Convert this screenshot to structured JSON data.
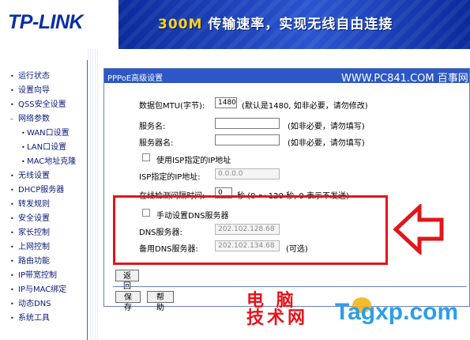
{
  "header": {
    "logo": "TP-LINK",
    "slogan_hi": "300M",
    "slogan_rest": "传输速率，实现无线自由连接"
  },
  "sidebar": {
    "items": [
      {
        "label": "运行状态",
        "bullet": "•"
      },
      {
        "label": "设置向导",
        "bullet": "•"
      },
      {
        "label": "QSS安全设置",
        "bullet": "•"
      },
      {
        "label": "网络参数",
        "bullet": "–"
      },
      {
        "label": "WAN口设置",
        "bullet": "•"
      },
      {
        "label": "LAN口设置",
        "bullet": "•"
      },
      {
        "label": "MAC地址克隆",
        "bullet": "•"
      },
      {
        "label": "无线设置",
        "bullet": "•"
      },
      {
        "label": "DHCP服务器",
        "bullet": "•"
      },
      {
        "label": "转发规则",
        "bullet": "•"
      },
      {
        "label": "安全设置",
        "bullet": "•"
      },
      {
        "label": "家长控制",
        "bullet": "•"
      },
      {
        "label": "上网控制",
        "bullet": "•"
      },
      {
        "label": "路由功能",
        "bullet": "•"
      },
      {
        "label": "IP带宽控制",
        "bullet": "•"
      },
      {
        "label": "IP与MAC绑定",
        "bullet": "•"
      },
      {
        "label": "动态DNS",
        "bullet": "•"
      },
      {
        "label": "系统工具",
        "bullet": "•"
      }
    ]
  },
  "panel": {
    "title": "PPPoE高级设置",
    "watermark": "WWW.PC841.COM 百事网"
  },
  "form": {
    "mtu_label": "数据包MTU(字节):",
    "mtu_value": "1480",
    "mtu_hint": "(默认是1480, 如非必要，请勿修改)",
    "service_label": "服务名:",
    "service_value": "",
    "service_hint": "(如非必要，请勿填写)",
    "server_label": "服务器名:",
    "server_value": "",
    "server_hint": "(如非必要，请勿填写)",
    "isp_ip_check_label": "使用ISP指定的IP地址",
    "isp_ip_label": "ISP指定的IP地址:",
    "isp_ip_value": "0.0.0.0",
    "detect_label": "在线检测间隔时间:",
    "detect_value": "0",
    "detect_hint": "秒 (0 ～ 120 秒, 0 表示不发送)",
    "dns_check_label": "手动设置DNS服务器",
    "dns1_label": "DNS服务器:",
    "dns1_value": "202.102.128.68",
    "dns2_label": "备用DNS服务器:",
    "dns2_value": "202.102.134.68",
    "dns2_hint": "(可选)"
  },
  "buttons": {
    "back": "返 回",
    "save": "保 存",
    "help": "帮 助"
  },
  "bottom_watermark": {
    "cn_line1": "电 脑",
    "cn_line2": "技术网",
    "site": "Tagxp.com"
  },
  "colors": {
    "brand_blue": "#0a2fa3",
    "panel_head": "#2d57c6",
    "annotation_red": "#e0161b",
    "watermark_blue": "#2b9ee8"
  }
}
